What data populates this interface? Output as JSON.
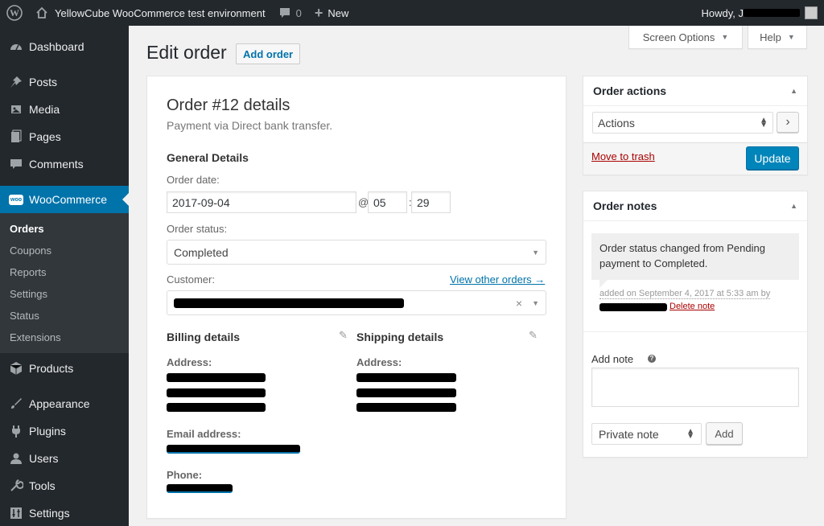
{
  "adminbar": {
    "site_name": "YellowCube WooCommerce test environment",
    "comments_count": "0",
    "new_label": "New",
    "howdy": "Howdy, J"
  },
  "sidebar": {
    "dashboard": "Dashboard",
    "posts": "Posts",
    "media": "Media",
    "pages": "Pages",
    "comments": "Comments",
    "woocommerce": "WooCommerce",
    "woo_icon_text": "Woo",
    "submenu": [
      "Orders",
      "Coupons",
      "Reports",
      "Settings",
      "Status",
      "Extensions"
    ],
    "products": "Products",
    "appearance": "Appearance",
    "plugins": "Plugins",
    "users": "Users",
    "tools": "Tools",
    "settings": "Settings"
  },
  "screen_options": "Screen Options",
  "help": "Help",
  "page_title": "Edit order",
  "add_order": "Add order",
  "order": {
    "heading": "Order #12 details",
    "payment": "Payment via Direct bank transfer.",
    "general_title": "General Details",
    "order_date_label": "Order date:",
    "order_date": "2017-09-04",
    "at": "@",
    "hour": "05",
    "colon": ":",
    "minute": "29",
    "status_label": "Order status:",
    "status": "Completed",
    "customer_label": "Customer:",
    "view_other_orders": "View other orders →",
    "clear": "×",
    "billing_title": "Billing details",
    "shipping_title": "Shipping details",
    "address_label": "Address:",
    "email_label": "Email address:",
    "phone_label": "Phone:"
  },
  "order_actions": {
    "title": "Order actions",
    "select_value": "Actions",
    "go": "›",
    "trash": "Move to trash",
    "update": "Update"
  },
  "order_notes": {
    "title": "Order notes",
    "note_text": "Order status changed from Pending payment to Completed.",
    "meta": "added on September 4, 2017 at 5:33 am by",
    "delete": "Delete note",
    "add_note_label": "Add note",
    "help": "?",
    "note_type": "Private note",
    "add_button": "Add"
  }
}
